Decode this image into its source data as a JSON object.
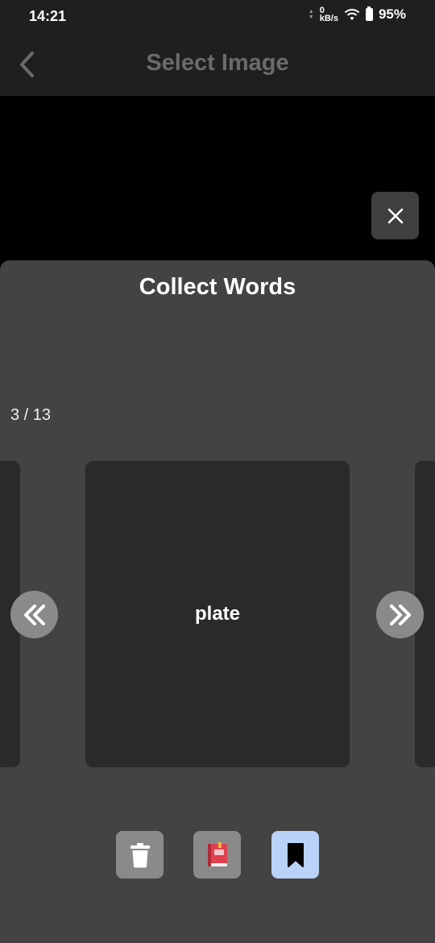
{
  "status_bar": {
    "time": "14:21",
    "net_speed_value": "0",
    "net_speed_unit": "kB/s",
    "battery": "95%"
  },
  "app_bar": {
    "title": "Select Image"
  },
  "sheet": {
    "title": "Collect Words",
    "counter": "3 / 13",
    "current_word": "plate"
  },
  "icons": {
    "back": "chevron-left-icon",
    "close": "close-icon",
    "prev": "double-chevron-left-icon",
    "next": "double-chevron-right-icon",
    "delete": "trash-icon",
    "dictionary": "book-icon",
    "bookmark": "bookmark-icon"
  },
  "colors": {
    "bookmark_active": "#b9d2f7",
    "dictionary_book": "#e0414f"
  }
}
